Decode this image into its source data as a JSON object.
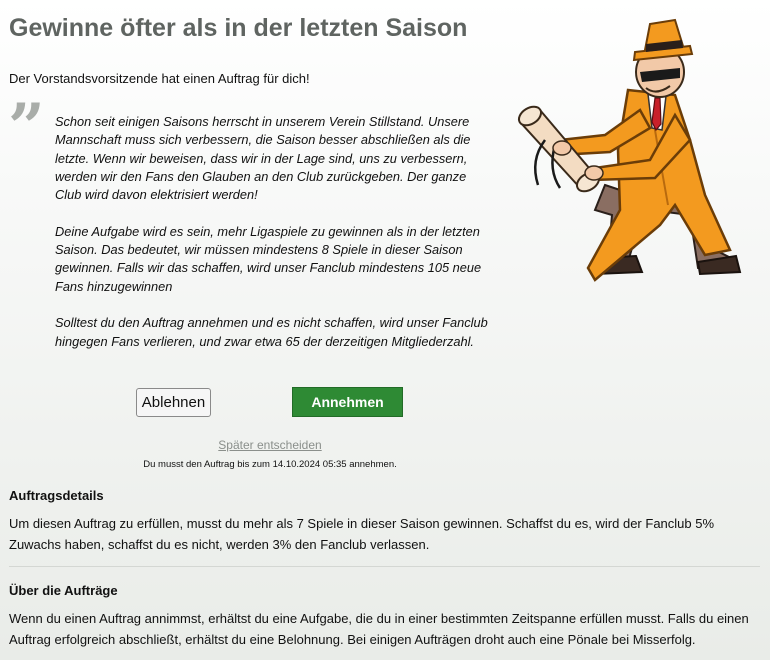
{
  "title": "Gewinne öfter als in der letzten Saison",
  "intro": "Der Vorstandsvorsitzende hat einen Auftrag für dich!",
  "quote": {
    "p1": "Schon seit einigen Saisons herrscht in unserem Verein Stillstand. Unsere Mannschaft muss sich verbessern, die Saison besser abschließen als die letzte. Wenn wir beweisen, dass wir in der Lage sind, uns zu verbessern, werden wir den Fans den Glauben an den Club zurückgeben. Der ganze Club wird davon elektrisiert werden!",
    "p2": "Deine Aufgabe wird es sein, mehr Ligaspiele zu gewinnen als in der letzten Saison. Das bedeutet, wir müssen mindestens 8 Spiele in dieser Saison gewinnen. Falls wir das schaffen, wird unser Fanclub mindestens 105 neue Fans hinzugewinnen",
    "p3": "Solltest du den Auftrag annehmen und es nicht schaffen, wird unser Fanclub hingegen Fans verlieren, und zwar etwa 65 der derzeitigen Mitgliederzahl."
  },
  "buttons": {
    "decline": "Ablehnen",
    "accept": "Annehmen",
    "later": "Später entscheiden"
  },
  "deadline": "Du musst den Auftrag bis zum 14.10.2024 05:35 annehmen.",
  "details": {
    "heading": "Auftragsdetails",
    "text": "Um diesen Auftrag zu erfüllen, musst du mehr als 7 Spiele in dieser Saison gewinnen. Schaffst du es, wird der Fanclub 5% Zuwachs haben, schaffst du es nicht, werden 3% den Fanclub verlassen."
  },
  "about": {
    "heading": "Über die Aufträge",
    "text": "Wenn du einen Auftrag annimmst, erhältst du eine Aufgabe, die du in einer bestimmten Zeitspanne erfüllen musst. Falls du einen Auftrag erfolgreich abschließt, erhältst du eine Belohnung. Bei einigen Aufträgen droht auch eine Pönale bei Misserfolg."
  },
  "colors": {
    "accent_green": "#2e8a34",
    "coat_orange": "#f39a1f",
    "title_gray": "#5f6461"
  },
  "icons": {
    "quote": "quote-mark-icon",
    "illustration": "chairman-with-scroll-illustration"
  }
}
